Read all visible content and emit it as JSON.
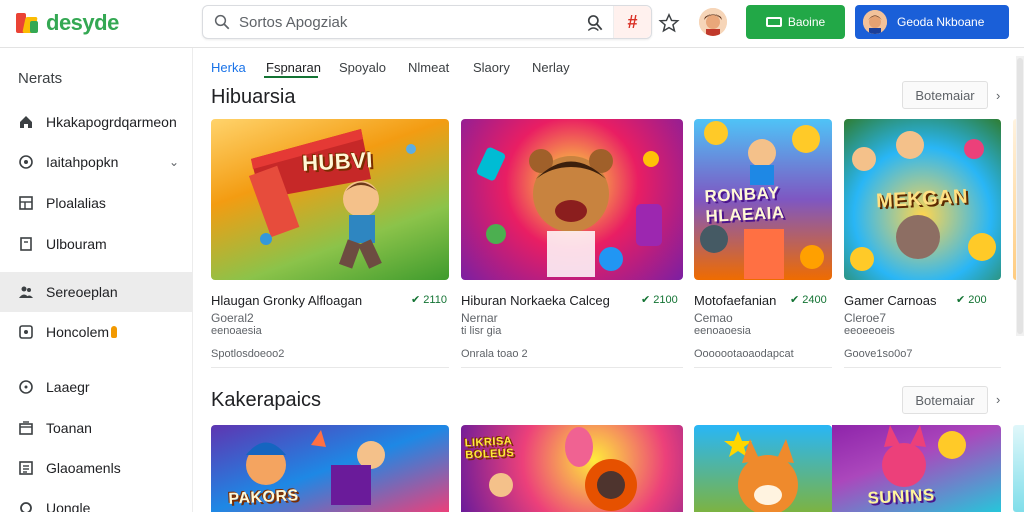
{
  "header": {
    "logo_text": "desyde",
    "search_placeholder": "Sortos Apogziak",
    "hash_symbol": "#",
    "green_button_label": "Baoine",
    "blue_button_label": "Geoda Nkboane"
  },
  "sidebar": {
    "title": "Nerats",
    "items": [
      {
        "label": "Hkakapogrdqarmeon",
        "icon": "home-icon"
      },
      {
        "label": "Iaitahpopkn",
        "icon": "gamepad-icon",
        "has_chevron": true
      },
      {
        "label": "Ploalalias",
        "icon": "grid-icon"
      },
      {
        "label": "Ulbouram",
        "icon": "bookmark-icon"
      },
      {
        "label": "Sereoeplan",
        "icon": "people-icon",
        "active": true
      },
      {
        "label": "Honcolem",
        "icon": "clock-icon",
        "badge": "flame"
      },
      {
        "label": "Laaegr",
        "icon": "info-icon"
      },
      {
        "label": "Toanan",
        "icon": "wallet-icon"
      },
      {
        "label": "Glaoamenls",
        "icon": "list-icon"
      },
      {
        "label": "Uongle",
        "icon": "settings-icon"
      }
    ]
  },
  "tabs": [
    {
      "label": "Herka"
    },
    {
      "label": "Fspnaran",
      "active": true
    },
    {
      "label": "Spoyalo"
    },
    {
      "label": "Nlmeat"
    },
    {
      "label": "Slaory"
    },
    {
      "label": "Nerlay"
    }
  ],
  "sections": [
    {
      "title": "Hibuarsia",
      "more_label": "Botemaiar",
      "cards": [
        {
          "banner": "HUBVI",
          "title": "Hlaugan Gronky Alfloagan",
          "price": "2110",
          "sub": "Goeral2",
          "sub2": "eenoaesia",
          "dev": "Spotlosdoeoo2"
        },
        {
          "banner": "",
          "title": "Hiburan Norkaeka Calceg",
          "price": "2100",
          "sub": "Nernar",
          "sub2": "ti lisr gia",
          "dev": "Onrala toao 2"
        },
        {
          "banner": "RONBAY HLAEAIA",
          "title": "Motofaefanian",
          "price": "2400",
          "sub": "Cemao",
          "sub2": "eenoaoesia",
          "dev": "Ooooootaoaodapcat"
        },
        {
          "banner": "MEKGAN",
          "title": "Gamer Carnoas",
          "price": "200",
          "sub": "Cleroe7",
          "sub2": "eeoeeoeis",
          "dev": "Goove1so0o7"
        }
      ]
    },
    {
      "title": "Kakerapaics",
      "more_label": "Botemaiar",
      "cards": [
        {
          "banner": "PAKORS"
        },
        {
          "banner": "LIKRISA BOLEUS"
        },
        {
          "banner": ""
        },
        {
          "banner": "SUNINS"
        }
      ]
    }
  ]
}
